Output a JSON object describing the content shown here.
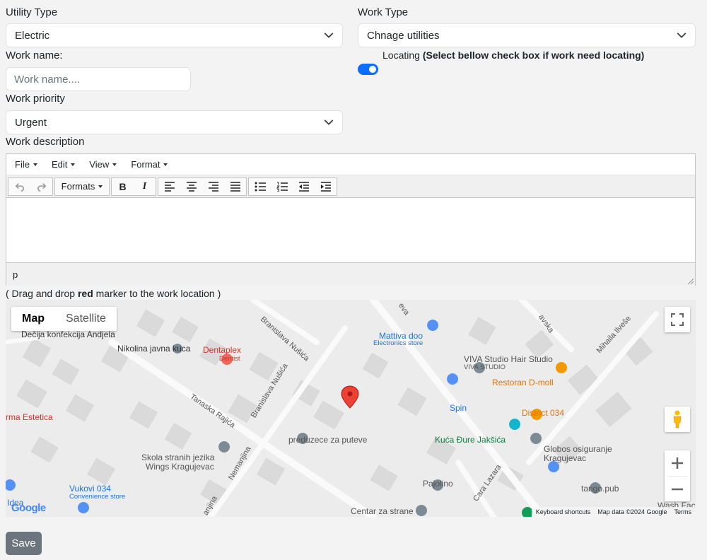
{
  "form": {
    "utility_type_label": "Utility Type",
    "utility_type_value": "Electric",
    "work_type_label": "Work Type",
    "work_type_value": "Chnage utilities",
    "work_name_label": "Work name:",
    "work_name_placeholder": "Work name....",
    "locating_label": "Locating ",
    "locating_hint": "(Select bellow check box if work need locating)",
    "locating_enabled": true,
    "work_priority_label": "Work priority",
    "work_priority_value": "Urgent",
    "work_description_label": "Work description",
    "save_label": "Save"
  },
  "editor": {
    "menu": [
      "File",
      "Edit",
      "View",
      "Format"
    ],
    "formats_label": "Formats",
    "bold_glyph": "B",
    "italic_glyph": "I",
    "status_path": "p"
  },
  "map_hint": {
    "prefix": "( Drag and drop ",
    "bold": "red",
    "suffix": " marker to the work location )"
  },
  "map": {
    "type_map": "Map",
    "type_satellite": "Satellite",
    "active_type": "Map",
    "google_logo": "Google",
    "attribution": [
      "Keyboard shortcuts",
      "Map data ©2024 Google",
      "Terms"
    ],
    "pois": [
      {
        "name": "Dečija konfekcija Andjela",
        "color": "#333"
      },
      {
        "name": "Nikolina javna kuca",
        "color": "#333"
      },
      {
        "name": "Dentaplex",
        "color": "#d93025"
      },
      {
        "name": "Dentist",
        "color": "#d93025"
      },
      {
        "name": "Mattiva doo",
        "color": "#1a73e8"
      },
      {
        "name": "Electronics store",
        "color": "#1a73e8"
      },
      {
        "name": "VIVA Studio Hair Studio",
        "color": "#555"
      },
      {
        "name": "VIVA STUDIO",
        "color": "#555"
      },
      {
        "name": "Restoran D-moll",
        "color": "#e37400"
      },
      {
        "name": "District 034",
        "color": "#e37400"
      },
      {
        "name": "Spin",
        "color": "#1a73e8"
      },
      {
        "name": "rma Estetica",
        "color": "#d93025"
      },
      {
        "name": "preduzece za puteve",
        "color": "#555"
      },
      {
        "name": "Kuća Đure Jakšića",
        "color": "#0b8043"
      },
      {
        "name": "Globos osiguranje",
        "color": "#555"
      },
      {
        "name": "Kragujevac",
        "color": "#555"
      },
      {
        "name": "Skola stranih jezika",
        "color": "#555"
      },
      {
        "name": "Wings Kragujevac",
        "color": "#555"
      },
      {
        "name": "Vukovi 034",
        "color": "#1a73e8"
      },
      {
        "name": "Convenience store",
        "color": "#1a73e8"
      },
      {
        "name": "Pajolino",
        "color": "#555"
      },
      {
        "name": "tango.pub",
        "color": "#555"
      },
      {
        "name": "Centar za strane",
        "color": "#555"
      },
      {
        "name": "Idea",
        "color": "#1a73e8"
      },
      {
        "name": "Wash Fac",
        "color": "#555"
      }
    ],
    "streets": [
      "Branislava Nušića",
      "Branislava Nušića",
      "Tanaska Rajića",
      "Nemanjina",
      "Cara Lazara",
      "Mihaila Ilveše",
      "avska",
      "eva",
      "anjina"
    ]
  }
}
